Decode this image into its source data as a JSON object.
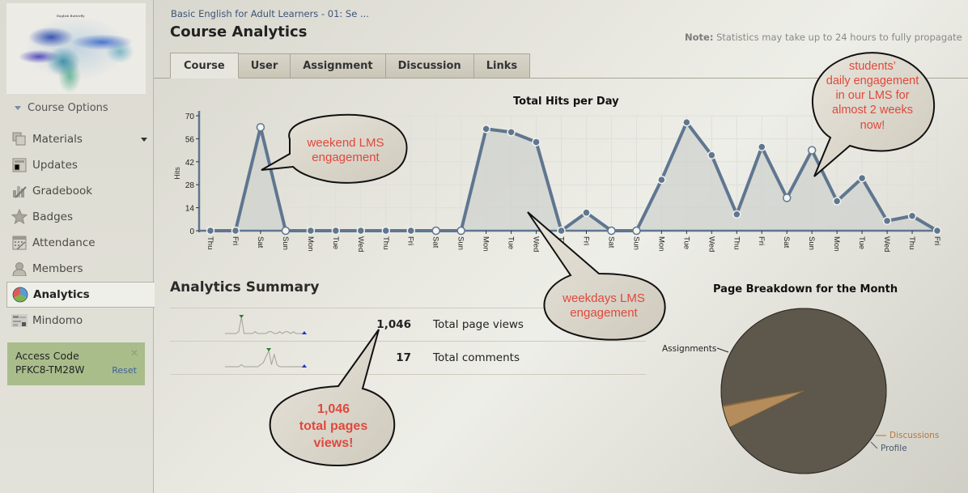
{
  "sidebar": {
    "course_image_caption": "English Butterfly",
    "course_options_label": "Course Options",
    "items": [
      {
        "label": "Materials",
        "icon": "materials-icon",
        "has_dropdown": true
      },
      {
        "label": "Updates",
        "icon": "updates-icon"
      },
      {
        "label": "Gradebook",
        "icon": "gradebook-icon"
      },
      {
        "label": "Badges",
        "icon": "badge-star-icon"
      },
      {
        "label": "Attendance",
        "icon": "attendance-calendar-icon"
      },
      {
        "label": "Members",
        "icon": "members-person-icon"
      },
      {
        "label": "Analytics",
        "icon": "analytics-pie-icon",
        "active": true
      },
      {
        "label": "Mindomo",
        "icon": "mindomo-icon"
      }
    ],
    "access_code": {
      "title": "Access Code",
      "code": "PFKC8-TM28W",
      "reset_label": "Reset",
      "close_glyph": "✕"
    }
  },
  "header": {
    "breadcrumb": "Basic English for Adult Learners - 01: Se ...",
    "title": "Course Analytics",
    "note_label": "Note:",
    "note_text": "Statistics may take up to 24 hours to fully propagate"
  },
  "tabs": [
    {
      "label": "Course",
      "active": true
    },
    {
      "label": "User"
    },
    {
      "label": "Assignment"
    },
    {
      "label": "Discussion"
    },
    {
      "label": "Links"
    }
  ],
  "chart_data": [
    {
      "type": "area",
      "title": "Total Hits per Day",
      "xlabel": "",
      "ylabel": "Hits",
      "ylim": [
        0,
        70
      ],
      "yticks": [
        0,
        14,
        28,
        42,
        56,
        70
      ],
      "grid": true,
      "categories": [
        "Thu",
        "Fri",
        "Sat",
        "Sun",
        "Mon",
        "Tue",
        "Wed",
        "Thu",
        "Fri",
        "Sat",
        "Sun",
        "Mon",
        "Tue",
        "Wed",
        "Thu",
        "Fri",
        "Sat",
        "Sun",
        "Mon",
        "Tue",
        "Wed",
        "Thu",
        "Fri",
        "Sat",
        "Sun",
        "Mon",
        "Tue",
        "Wed",
        "Thu",
        "Fri"
      ],
      "values": [
        0,
        0,
        63,
        0,
        0,
        0,
        0,
        0,
        0,
        0,
        0,
        62,
        60,
        54,
        0,
        11,
        0,
        0,
        31,
        66,
        46,
        10,
        51,
        20,
        49,
        18,
        32,
        6,
        9,
        0
      ],
      "weekend_hollow_markers": true,
      "colors": {
        "line": "#5f7690",
        "fill": "#cfd1cd",
        "grid": "#dedfdb"
      }
    },
    {
      "type": "pie",
      "title": "Page Breakdown for the Month",
      "slices": [
        {
          "label": "Assignments",
          "value": 95.6,
          "color": "#5e574c",
          "label_color": "#222222"
        },
        {
          "label": "Discussions",
          "value": 4.2,
          "color": "#b58c5c",
          "label_color": "#b5763d"
        },
        {
          "label": "Profile",
          "value": 0.2,
          "color": "#56606b",
          "label_color": "#4a5a6c"
        }
      ],
      "legend": "inline-labels"
    }
  ],
  "summary": {
    "title": "Analytics Summary",
    "rows": [
      {
        "value": "1,046",
        "label": "Total page views",
        "sparkline": [
          0,
          0,
          0,
          0,
          0,
          1,
          9,
          0,
          0,
          0,
          0,
          1,
          0,
          0,
          0,
          0,
          1,
          1,
          0,
          0,
          1,
          0,
          1,
          1,
          0,
          1,
          0,
          0,
          0,
          0
        ]
      },
      {
        "value": "17",
        "label": "Total comments",
        "sparkline": [
          0,
          0,
          0,
          0,
          0,
          0,
          1,
          0,
          0,
          0,
          0,
          0,
          0,
          1,
          2,
          5,
          8,
          1,
          6,
          1,
          0,
          0,
          0,
          0,
          0,
          0,
          0,
          0,
          0,
          0
        ]
      }
    ]
  },
  "callouts": [
    {
      "id": "weekend",
      "lines": [
        "weekend LMS",
        "engagement"
      ]
    },
    {
      "id": "weekdays",
      "lines": [
        "weekdays LMS",
        "engagement"
      ]
    },
    {
      "id": "students",
      "lines": [
        "students’",
        "daily engagement",
        "in our LMS for",
        "almost 2 weeks",
        "now!"
      ]
    },
    {
      "id": "pageviews",
      "lines": [
        "1,046",
        "total pages",
        "views!"
      ]
    }
  ]
}
